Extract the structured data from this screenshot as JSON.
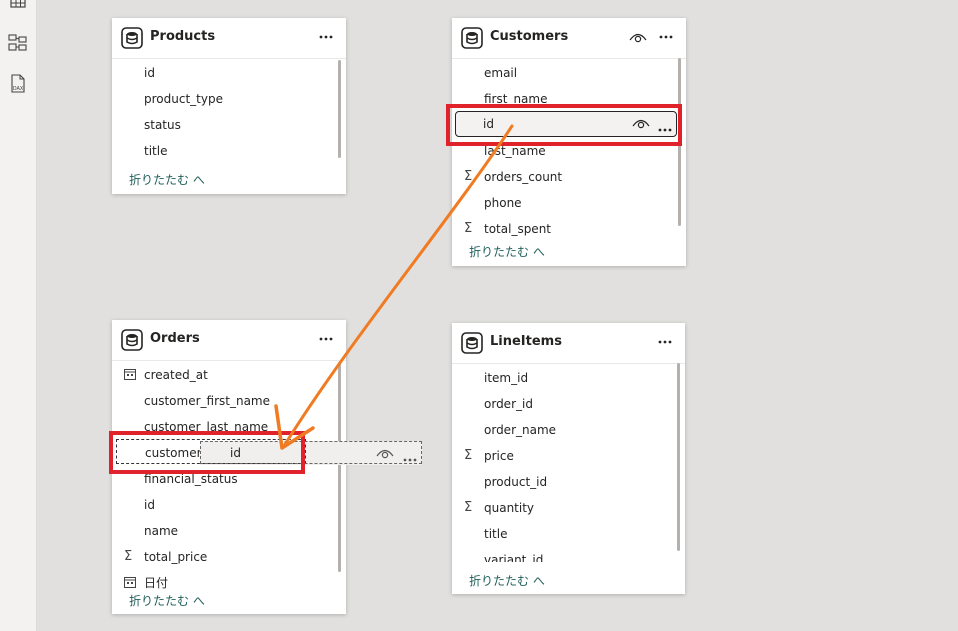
{
  "sidebar": {
    "items": [
      {
        "icon": "table-view-icon"
      },
      {
        "icon": "model-view-icon"
      },
      {
        "icon": "dax-query-view-icon",
        "label": "DAX"
      }
    ]
  },
  "tables": {
    "products": {
      "title": "Products",
      "fields": [
        {
          "label": "id",
          "icon": ""
        },
        {
          "label": "product_type",
          "icon": ""
        },
        {
          "label": "status",
          "icon": ""
        },
        {
          "label": "title",
          "icon": ""
        }
      ],
      "collapse_label": "折りたたむ へ"
    },
    "customers": {
      "title": "Customers",
      "fields": [
        {
          "label": "email",
          "icon": ""
        },
        {
          "label": "first_name",
          "icon": ""
        },
        {
          "label": "id",
          "icon": ""
        },
        {
          "label": "last_name",
          "icon": ""
        },
        {
          "label": "orders_count",
          "icon": "Σ"
        },
        {
          "label": "phone",
          "icon": ""
        },
        {
          "label": "total_spent",
          "icon": "Σ"
        }
      ],
      "collapse_label": "折りたたむ へ"
    },
    "orders": {
      "title": "Orders",
      "fields": [
        {
          "label": "created_at",
          "icon": "calendar"
        },
        {
          "label": "customer_first_name",
          "icon": ""
        },
        {
          "label": "customer_last_name",
          "icon": ""
        },
        {
          "label": "customer.id",
          "icon": ""
        },
        {
          "label": "financial_status",
          "icon": ""
        },
        {
          "label": "id",
          "icon": ""
        },
        {
          "label": "name",
          "icon": ""
        },
        {
          "label": "total_price",
          "icon": "Σ"
        },
        {
          "label": "日付",
          "icon": "calendar"
        }
      ],
      "collapse_label": "折りたたむ へ"
    },
    "lineitems": {
      "title": "LineItems",
      "fields": [
        {
          "label": "item_id",
          "icon": ""
        },
        {
          "label": "order_id",
          "icon": ""
        },
        {
          "label": "order_name",
          "icon": ""
        },
        {
          "label": "price",
          "icon": "Σ"
        },
        {
          "label": "product_id",
          "icon": ""
        },
        {
          "label": "quantity",
          "icon": "Σ"
        },
        {
          "label": "title",
          "icon": ""
        },
        {
          "label": "variant_id",
          "icon": ""
        }
      ],
      "collapse_label": "折りたたむ へ"
    }
  },
  "drag": {
    "ghost_label": "id",
    "source_table": "Customers",
    "source_field": "id",
    "target_table": "Orders",
    "target_field": "customer.id"
  },
  "colors": {
    "highlight": "#e0222a",
    "arrow": "#f07b22",
    "collapse_link": "#1f5f5a",
    "canvas": "#e1e0df"
  }
}
